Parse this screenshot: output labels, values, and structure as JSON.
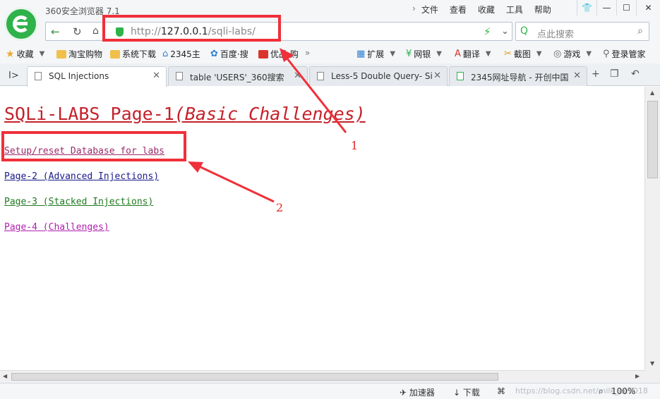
{
  "window": {
    "app_title": "360安全浏览器 7.1",
    "menu": [
      "文件",
      "查看",
      "收藏",
      "工具",
      "帮助"
    ]
  },
  "address": {
    "url_prefix": "http://",
    "url_host": "127.0.0.1",
    "url_path": "/sqli-labs/",
    "search_placeholder": "点此搜索"
  },
  "bookmarks": {
    "left": [
      "收藏",
      "淘宝购物",
      "系统下载",
      "2345主",
      "百度·搜",
      "优品·购"
    ],
    "right": [
      "扩展",
      "网银",
      "翻译",
      "截图",
      "游戏",
      "登录管家"
    ]
  },
  "tabs": [
    {
      "label": "SQL Injections",
      "active": true
    },
    {
      "label": "table 'USERS'_360搜索",
      "active": false
    },
    {
      "label": "Less-5 Double Query- Si",
      "active": false
    },
    {
      "label": "2345网址导航 - 开创中国",
      "active": false
    }
  ],
  "page": {
    "title_main": "SQLi-LABS Page-1",
    "title_sub": "(Basic Challenges)",
    "links": [
      "Setup/reset Database for labs",
      "Page-2 (Advanced Injections)",
      "Page-3 (Stacked Injections)",
      "Page-4 (Challenges)"
    ]
  },
  "status": {
    "accelerator": "加速器",
    "download": "下载",
    "zoom": "100%",
    "watermark": "https://blog.csdn.net/milk_ee2018"
  },
  "annotations": {
    "label_1": "1",
    "label_2": "2",
    "color": "#f0303a"
  },
  "colors": {
    "title": "#c4212a",
    "brand_green": "#2fb24a"
  }
}
